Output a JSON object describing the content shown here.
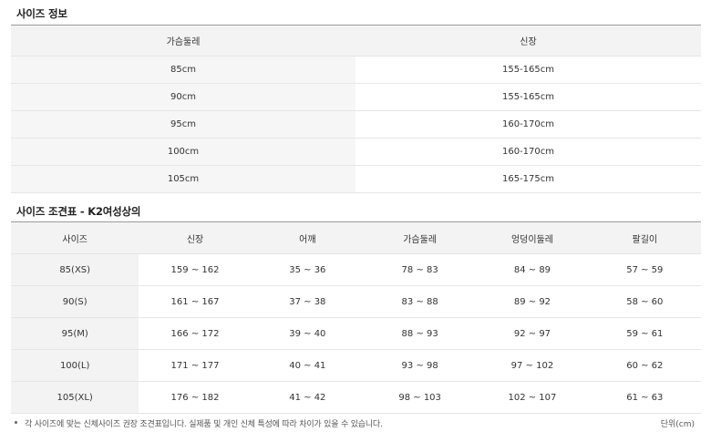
{
  "size_info": {
    "title": "사이즈 정보",
    "headers": [
      "가슴둘레",
      "신장"
    ],
    "rows": [
      [
        "85cm",
        "155-165cm"
      ],
      [
        "90cm",
        "155-165cm"
      ],
      [
        "95cm",
        "160-170cm"
      ],
      [
        "100cm",
        "160-170cm"
      ],
      [
        "105cm",
        "165-175cm"
      ]
    ]
  },
  "size_chart": {
    "title": "사이즈 조견표 - K2여성상의",
    "headers": [
      "사이즈",
      "신장",
      "어깨",
      "가슴둘레",
      "엉덩이둘레",
      "팔길이"
    ],
    "rows": [
      [
        "85(XS)",
        "159 ~ 162",
        "35 ~ 36",
        "78 ~ 83",
        "84 ~ 89",
        "57 ~ 59"
      ],
      [
        "90(S)",
        "161 ~ 167",
        "37 ~ 38",
        "83 ~ 88",
        "89 ~ 92",
        "58 ~ 60"
      ],
      [
        "95(M)",
        "166 ~ 172",
        "39 ~ 40",
        "88 ~ 93",
        "92 ~ 97",
        "59 ~ 61"
      ],
      [
        "100(L)",
        "171 ~ 177",
        "40 ~ 41",
        "93 ~ 98",
        "97 ~ 102",
        "60 ~ 62"
      ],
      [
        "105(XL)",
        "176 ~ 182",
        "41 ~ 42",
        "98 ~ 103",
        "102 ~ 107",
        "61 ~ 63"
      ]
    ]
  },
  "footnote": "각 사이즈에 맞는 신체사이즈 권장 조견표입니다. 실제품 및 개인 신체 특성에 따라 차이가 있을 수 있습니다.",
  "unit_label": "단위(cm)",
  "colors": {
    "header_bg": "#f3f3f3",
    "border_top": "#9a9a9a",
    "row_border": "#e6e6e6"
  }
}
